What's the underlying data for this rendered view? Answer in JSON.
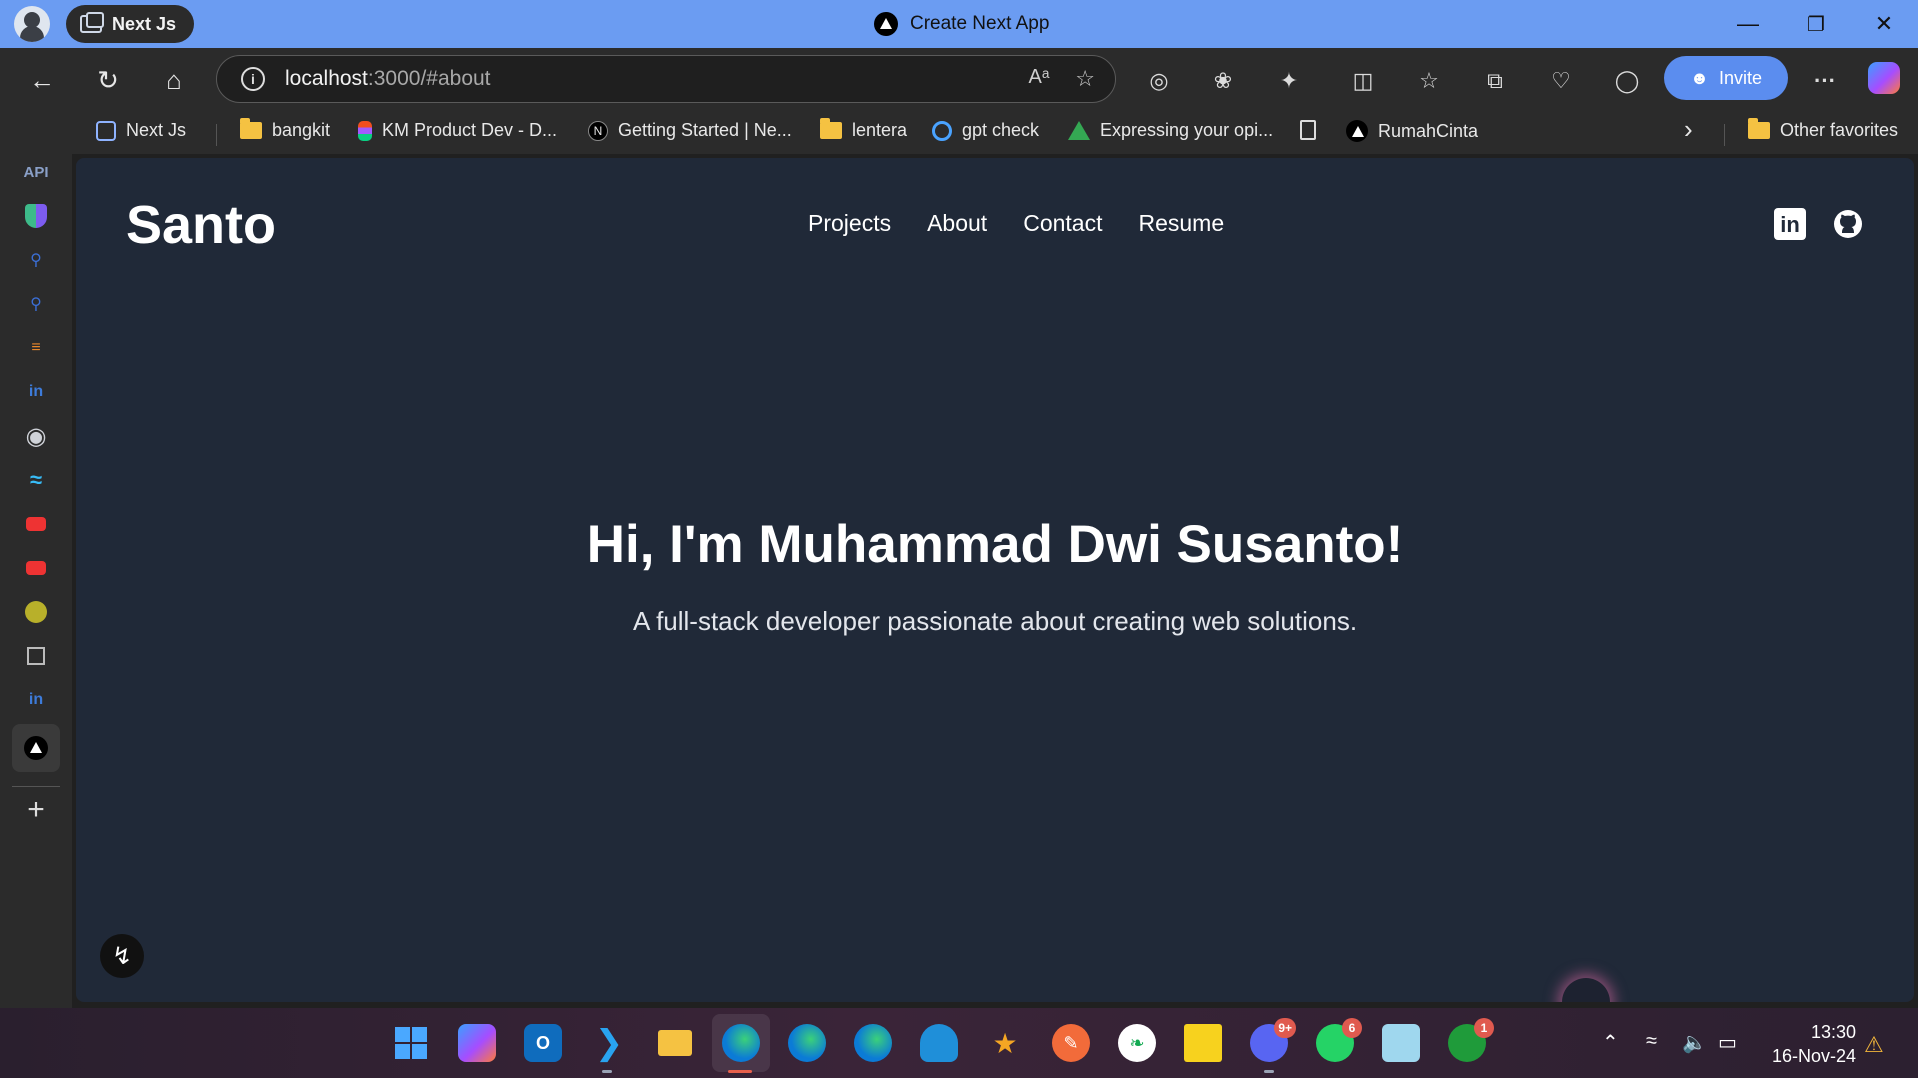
{
  "browser": {
    "tab_label": "Next Js",
    "window_title": "Create Next App",
    "url_host": "localhost",
    "url_rest": ":3000/#about",
    "invite_label": "Invite",
    "more_label": "···",
    "overflow_label": "›"
  },
  "bookmarks": [
    {
      "label": "Next Js",
      "icon": "next-js-icon"
    },
    {
      "label": "bangkit",
      "icon": "folder-icon"
    },
    {
      "label": "KM Product Dev - D...",
      "icon": "figma-icon"
    },
    {
      "label": "Getting Started | Ne...",
      "icon": "nextjs-n-icon"
    },
    {
      "label": "lentera",
      "icon": "folder-icon"
    },
    {
      "label": "gpt check",
      "icon": "gpt-check-icon"
    },
    {
      "label": "Expressing your opi...",
      "icon": "google-drive-icon"
    },
    {
      "label": "RumahCinta",
      "icon": "vercel-icon"
    },
    {
      "label": "Other favorites",
      "icon": "folder-icon"
    }
  ],
  "sidebar": {
    "api_label": "API",
    "linkedin_label": "in",
    "linkedin_label_2": "in"
  },
  "page": {
    "brand": "Santo",
    "nav": [
      "Projects",
      "About",
      "Contact",
      "Resume"
    ],
    "hero_title": "Hi, I'm Muhammad Dwi Susanto!",
    "hero_subtitle": "A full-stack developer passionate about creating web solutions.",
    "linkedin_text": "in"
  },
  "taskbar": {
    "discord_badge": "9+",
    "whatsapp_badge": "6",
    "xbox_badge": "1",
    "time": "13:30",
    "date": "16-Nov-24"
  },
  "colors": {
    "titlebar": "#6b9cf2",
    "chrome": "#2b2b2b",
    "page_bg": "#202938",
    "invite_button": "#5b8def"
  }
}
